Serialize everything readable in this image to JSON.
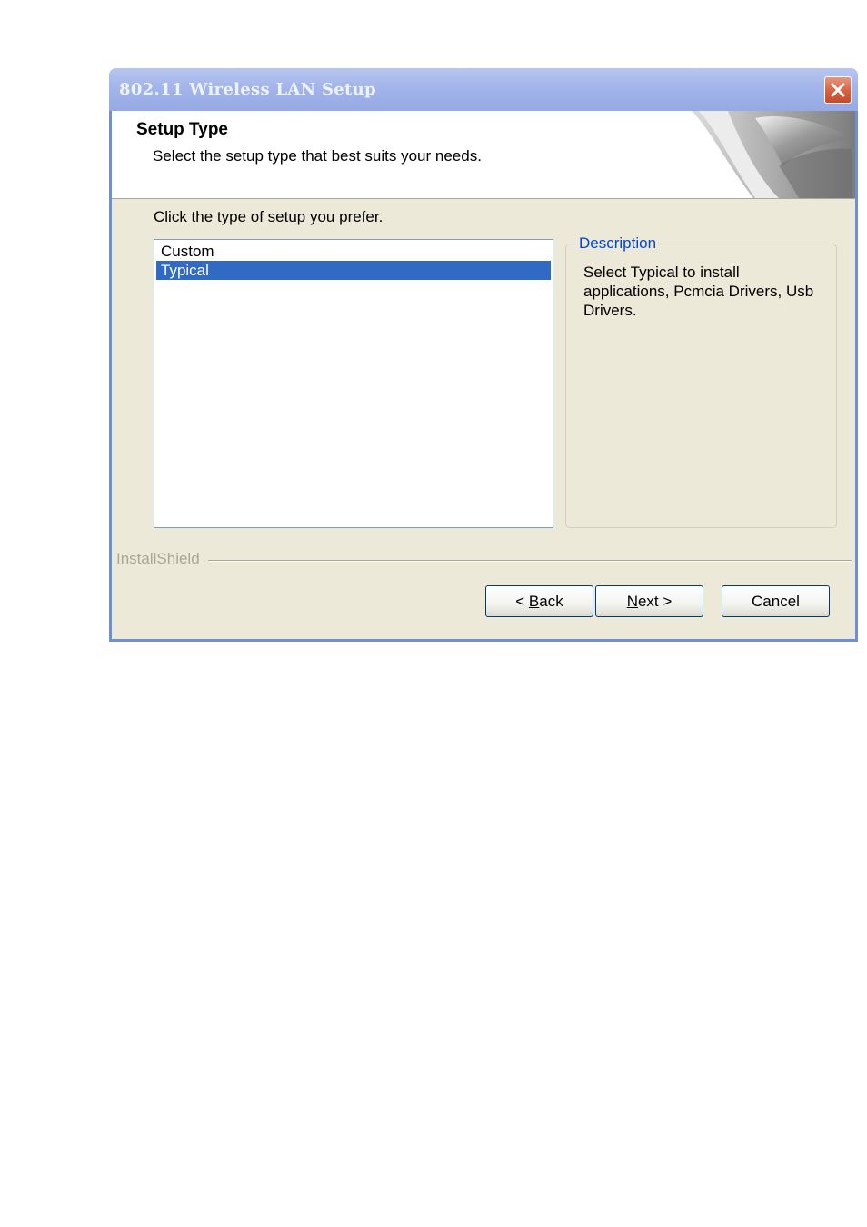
{
  "window": {
    "title": "802.11 Wireless LAN Setup",
    "close_icon": "close-x-icon"
  },
  "header": {
    "title": "Setup Type",
    "subtitle": "Select the setup type that best suits your needs."
  },
  "main": {
    "prompt": "Click the type of setup you prefer.",
    "setup_types": [
      {
        "label": "Custom",
        "selected": false
      },
      {
        "label": "Typical",
        "selected": true
      }
    ],
    "description": {
      "legend": "Description",
      "text": "Select Typical to install applications, Pcmcia Drivers, Usb Drivers."
    }
  },
  "footer": {
    "brand": "InstallShield",
    "back": {
      "prefix": "< ",
      "accel": "B",
      "rest": "ack"
    },
    "next": {
      "prefix": "",
      "accel": "N",
      "rest": "ext >"
    },
    "cancel": "Cancel"
  },
  "colors": {
    "title_bar": "#a4b6ea",
    "selection": "#316ac5",
    "face": "#ece9d8",
    "legend": "#0046d5"
  }
}
